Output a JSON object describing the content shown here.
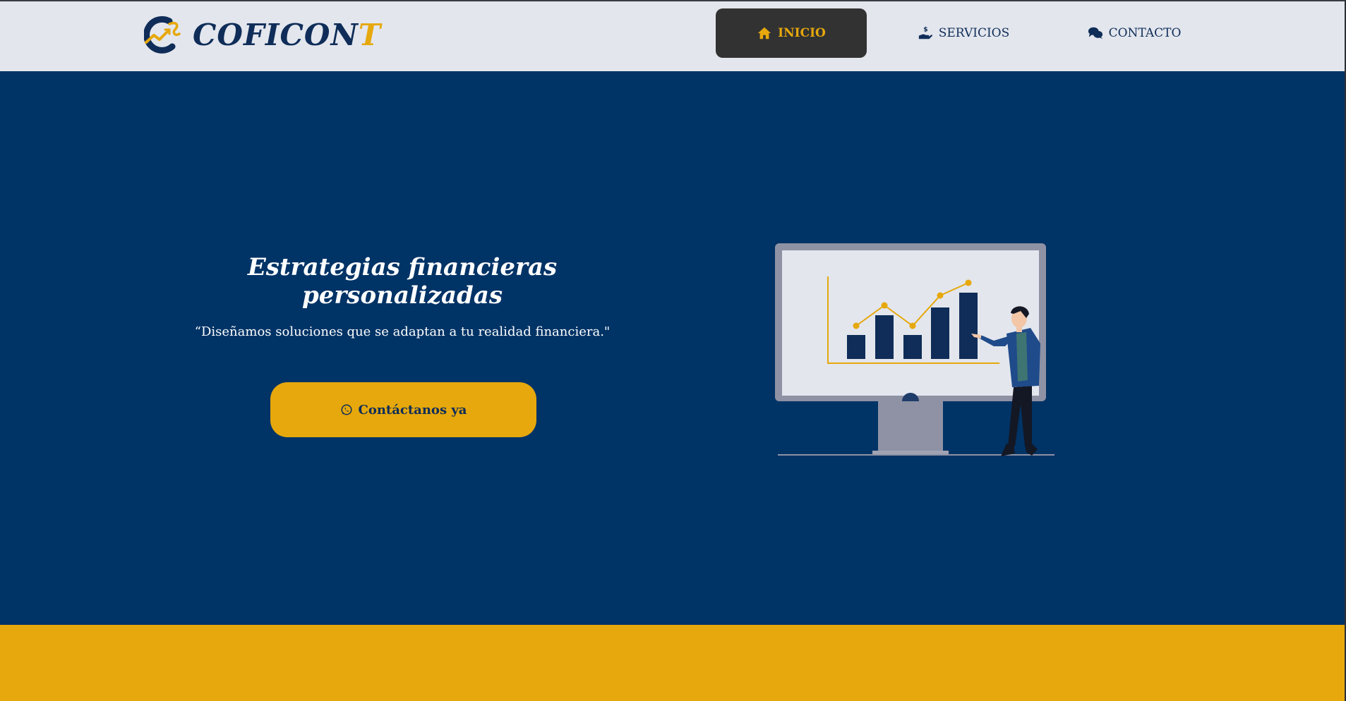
{
  "brand": {
    "name_main": "COFICON",
    "name_last": "T"
  },
  "nav": {
    "items": [
      {
        "label": "INICIO",
        "icon": "home-icon"
      },
      {
        "label": "SERVICIOS",
        "icon": "hand-dollar-icon"
      },
      {
        "label": "CONTACTO",
        "icon": "chat-bubbles-icon"
      }
    ],
    "active": "INICIO"
  },
  "hero": {
    "title": "Estrategias financieras personalizadas",
    "quote": "“Diseñamos soluciones que se adaptan a tu realidad financiera.\"",
    "cta_label": "Contáctanos ya",
    "cta_icon": "whatsapp-icon",
    "illustration": "presenter-with-chart"
  },
  "colors": {
    "navy": "#003366",
    "brand_dark": "#0f2d58",
    "gold": "#e6a80c",
    "nav_bg": "#e3e6ed",
    "active_bg": "#323232"
  }
}
